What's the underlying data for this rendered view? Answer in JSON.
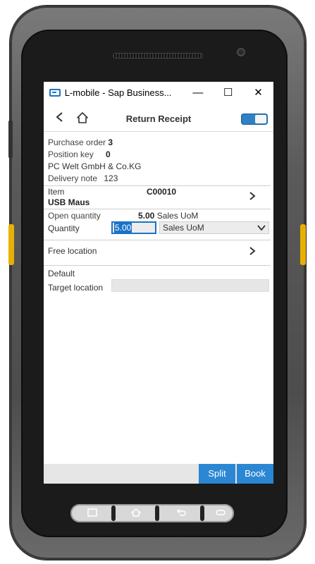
{
  "window": {
    "title": "L-mobile - Sap Business...",
    "minimize": "—",
    "maximize": "☐",
    "close": "✕"
  },
  "nav": {
    "title": "Return Receipt"
  },
  "header": {
    "purchase_order_label": "Purchase order",
    "purchase_order_value": "3",
    "position_key_label": "Position key",
    "position_key_value": "0",
    "vendor": "PC Welt GmbH & Co.KG",
    "delivery_note_label": "Delivery note",
    "delivery_note_value": "123"
  },
  "item": {
    "label": "Item",
    "code": "C00010",
    "name": "USB Maus"
  },
  "open_quantity": {
    "label": "Open quantity",
    "value": "5.00",
    "uom": "Sales UoM"
  },
  "quantity": {
    "label": "Quantity",
    "value": "5.00",
    "uom_selected": "Sales UoM"
  },
  "free_location": {
    "label": "Free location"
  },
  "default_label": "Default",
  "target_location": {
    "label": "Target location",
    "value": ""
  },
  "buttons": {
    "split": "Split",
    "book": "Book"
  },
  "colors": {
    "accent": "#2b87d3",
    "toggle": "#2f80c4",
    "device_key": "#e8b000"
  }
}
